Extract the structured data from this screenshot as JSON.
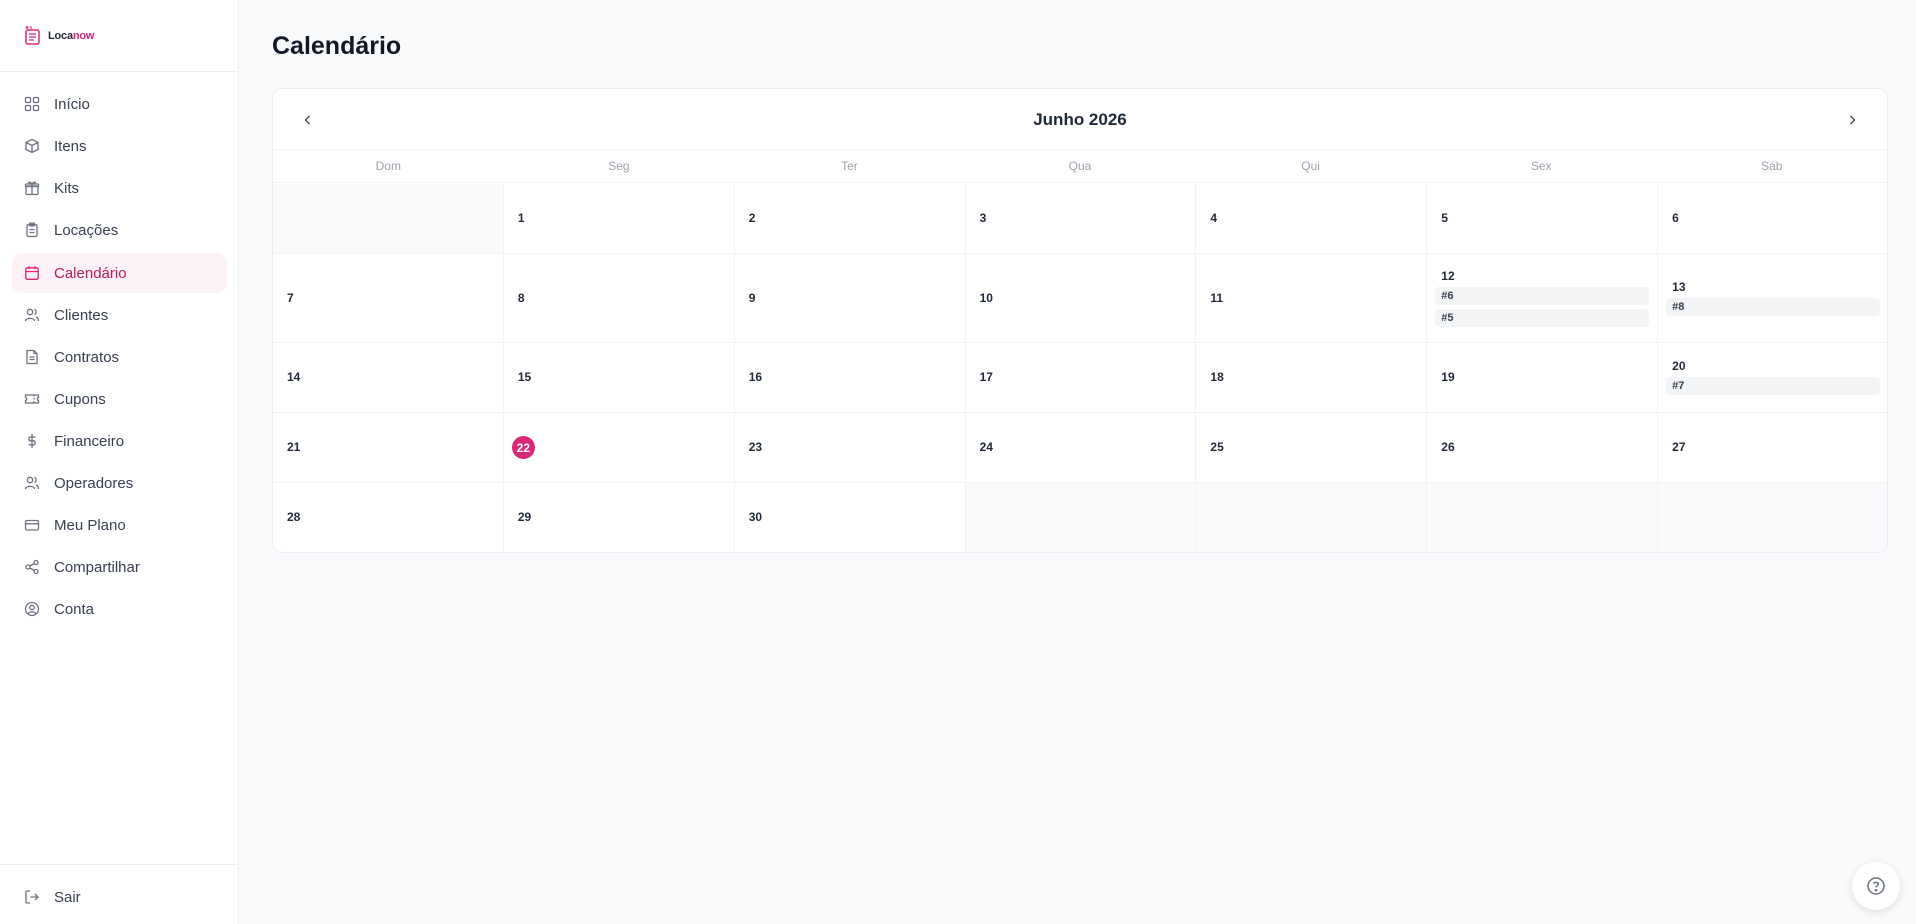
{
  "app": {
    "brand_part1": "Loca",
    "brand_part2": "now",
    "accent_color": "#db2777"
  },
  "sidebar": {
    "items": [
      {
        "label": "Início",
        "icon": "grid-icon"
      },
      {
        "label": "Itens",
        "icon": "box-icon"
      },
      {
        "label": "Kits",
        "icon": "gift-icon"
      },
      {
        "label": "Locações",
        "icon": "clipboard-icon"
      },
      {
        "label": "Calendário",
        "icon": "calendar-icon",
        "active": true
      },
      {
        "label": "Clientes",
        "icon": "users-icon"
      },
      {
        "label": "Contratos",
        "icon": "file-text-icon"
      },
      {
        "label": "Cupons",
        "icon": "ticket-icon"
      },
      {
        "label": "Financeiro",
        "icon": "dollar-icon"
      },
      {
        "label": "Operadores",
        "icon": "user-group-icon"
      },
      {
        "label": "Meu Plano",
        "icon": "credit-card-icon"
      },
      {
        "label": "Compartilhar",
        "icon": "share-icon"
      },
      {
        "label": "Conta",
        "icon": "user-circle-icon"
      }
    ],
    "logout_label": "Sair"
  },
  "page": {
    "title": "Calendário"
  },
  "calendar": {
    "month_label": "Junho 2026",
    "weekdays": [
      "Dom",
      "Seg",
      "Ter",
      "Qua",
      "Qui",
      "Sex",
      "Sáb"
    ],
    "today": 22,
    "weeks": [
      [
        null,
        {
          "day": 1
        },
        {
          "day": 2
        },
        {
          "day": 3
        },
        {
          "day": 4
        },
        {
          "day": 5
        },
        {
          "day": 6
        }
      ],
      [
        {
          "day": 7
        },
        {
          "day": 8
        },
        {
          "day": 9
        },
        {
          "day": 10
        },
        {
          "day": 11
        },
        {
          "day": 12,
          "events": [
            "#6",
            "#5"
          ]
        },
        {
          "day": 13,
          "events": [
            "#8"
          ]
        }
      ],
      [
        {
          "day": 14
        },
        {
          "day": 15
        },
        {
          "day": 16
        },
        {
          "day": 17
        },
        {
          "day": 18
        },
        {
          "day": 19
        },
        {
          "day": 20,
          "events": [
            "#7"
          ]
        }
      ],
      [
        {
          "day": 21
        },
        {
          "day": 22
        },
        {
          "day": 23
        },
        {
          "day": 24
        },
        {
          "day": 25
        },
        {
          "day": 26
        },
        {
          "day": 27
        }
      ],
      [
        {
          "day": 28
        },
        {
          "day": 29
        },
        {
          "day": 30
        },
        null,
        null,
        null,
        null
      ]
    ]
  },
  "help": {
    "icon": "help-circle-icon"
  }
}
